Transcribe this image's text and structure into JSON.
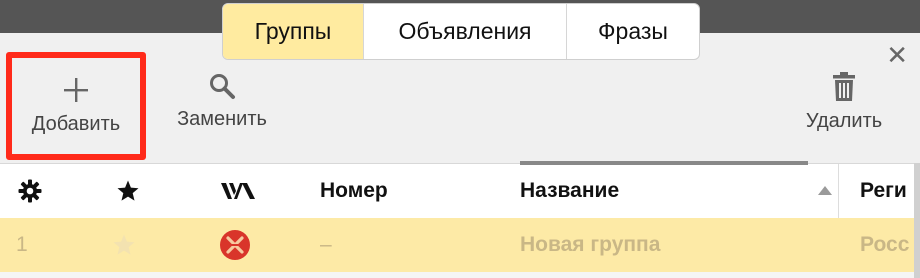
{
  "tabs": [
    {
      "label": "Группы",
      "active": true
    },
    {
      "label": "Объявления",
      "active": false
    },
    {
      "label": "Фразы",
      "active": false
    }
  ],
  "toolbar": {
    "add_label": "Добавить",
    "replace_label": "Заменить",
    "delete_label": "Удалить",
    "close_icon": "close-icon"
  },
  "table": {
    "headers": {
      "settings_icon": "gear-icon",
      "star_icon": "star-icon",
      "status_icon": "status-icon",
      "number": "Номер",
      "name": "Название",
      "region": "Реги"
    },
    "rows": [
      {
        "num": "1",
        "number": "–",
        "name": "Новая группа",
        "region": "Росс"
      }
    ]
  },
  "colors": {
    "active_tab": "#ffeba0",
    "selected_row": "#fdeaa6",
    "highlight_box": "#ff2a1a",
    "status_icon_red": "#d9352a"
  }
}
